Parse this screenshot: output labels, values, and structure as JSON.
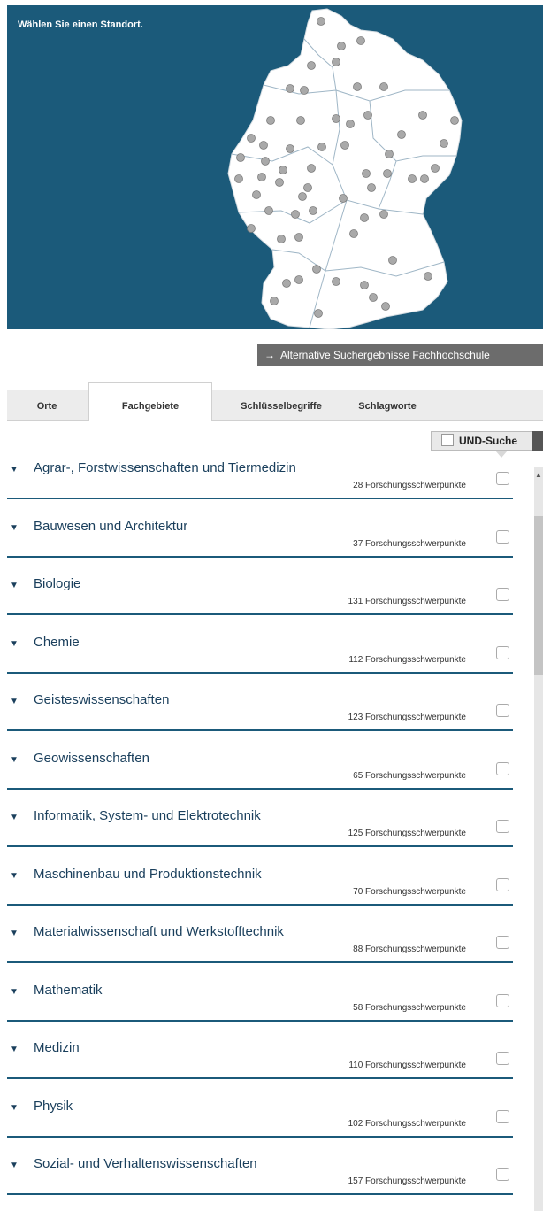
{
  "map": {
    "title": "Wählen Sie einen Standort.",
    "bg_color": "#1b5a7a"
  },
  "alt_button": {
    "arrow": "→",
    "label": "Alternative Suchergebnisse Fachhochschule"
  },
  "tabs": [
    {
      "label": "Orte",
      "active": false
    },
    {
      "label": "Fachgebiete",
      "active": true
    },
    {
      "label": "Schlüsselbegriffe",
      "active": false
    },
    {
      "label": "Schlagworte",
      "active": false
    }
  ],
  "und_search": {
    "label": "UND-Suche",
    "checked": false
  },
  "categories": [
    {
      "name": "Agrar-, Forstwissenschaften und Tiermedizin",
      "count": "28 Forschungsschwerpunkte"
    },
    {
      "name": "Bauwesen und Architektur",
      "count": "37 Forschungsschwerpunkte"
    },
    {
      "name": "Biologie",
      "count": "131 Forschungsschwerpunkte"
    },
    {
      "name": "Chemie",
      "count": "112 Forschungsschwerpunkte"
    },
    {
      "name": "Geisteswissenschaften",
      "count": "123 Forschungsschwerpunkte"
    },
    {
      "name": "Geowissenschaften",
      "count": "65 Forschungsschwerpunkte"
    },
    {
      "name": "Informatik, System- und Elektrotechnik",
      "count": "125 Forschungsschwerpunkte"
    },
    {
      "name": "Maschinenbau und Produktionstechnik",
      "count": "70 Forschungsschwerpunkte"
    },
    {
      "name": "Materialwissenschaft und Werkstofftechnik",
      "count": "88 Forschungsschwerpunkte"
    },
    {
      "name": "Mathematik",
      "count": "58 Forschungsschwerpunkte"
    },
    {
      "name": "Medizin",
      "count": "110 Forschungsschwerpunkte"
    },
    {
      "name": "Physik",
      "count": "102 Forschungsschwerpunkte"
    },
    {
      "name": "Sozial- und Verhaltenswissenschaften",
      "count": "157 Forschungsschwerpunkte"
    }
  ],
  "icons": {
    "caret": "caret-down-icon",
    "checkbox": "checkbox-icon",
    "location": "location-marker-icon"
  },
  "colors": {
    "accent": "#1b5a7a",
    "button": "#6c6c6c",
    "tab_bg": "#ececec"
  }
}
